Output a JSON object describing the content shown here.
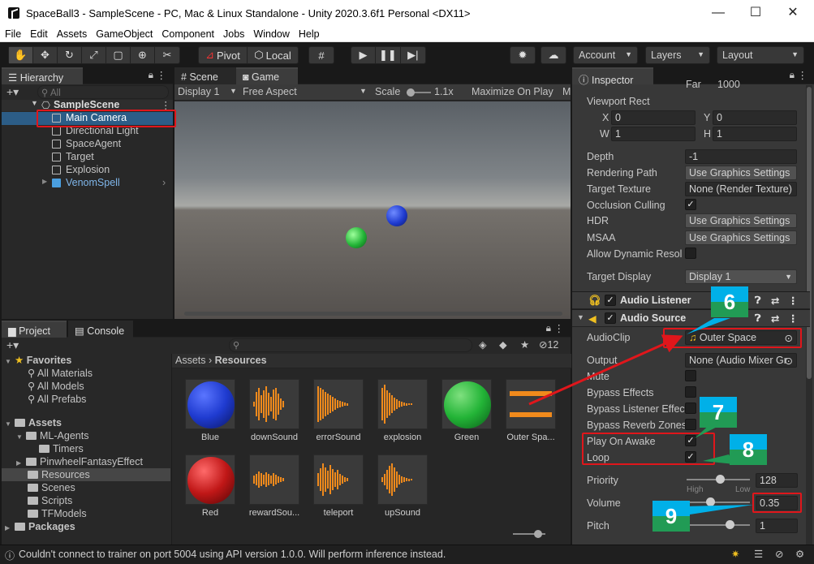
{
  "window": {
    "title": "SpaceBall3 - SampleScene - PC, Mac & Linux Standalone - Unity 2020.3.6f1 Personal <DX11>",
    "minimize": "—",
    "maximize": "☐",
    "close": "✕"
  },
  "menu": [
    "File",
    "Edit",
    "Assets",
    "GameObject",
    "Component",
    "Jobs",
    "Window",
    "Help"
  ],
  "toolbar": {
    "pivot": "Pivot",
    "local": "Local",
    "account": "Account",
    "layers": "Layers",
    "layout": "Layout"
  },
  "hierarchy": {
    "tab": "Hierarchy",
    "search_placeholder": "All",
    "scene": "SampleScene",
    "items": [
      "Main Camera",
      "Directional Light",
      "SpaceAgent",
      "Target",
      "Explosion",
      "VenomSpell"
    ]
  },
  "scene_tabs": {
    "scene": "Scene",
    "game": "Game"
  },
  "game_toolbar": {
    "display": "Display 1",
    "aspect": "Free Aspect",
    "scale_label": "Scale",
    "scale_value": "1.1x",
    "maximize": "Maximize On Play",
    "more": "M"
  },
  "project": {
    "tab_project": "Project",
    "tab_console": "Console",
    "hidden_count": "12",
    "breadcrumb_root": "Assets",
    "breadcrumb_current": "Resources",
    "tree": {
      "favorites": "Favorites",
      "fav_items": [
        "All Materials",
        "All Models",
        "All Prefabs"
      ],
      "assets": "Assets",
      "ml_agents": "ML-Agents",
      "timers": "Timers",
      "pinwheel": "PinwheelFantasyEffect",
      "resources": "Resources",
      "scenes": "Scenes",
      "scripts": "Scripts",
      "tfmodels": "TFModels",
      "packages": "Packages"
    },
    "assets": [
      "Blue",
      "downSound",
      "errorSound",
      "explosion",
      "Green",
      "Outer Spa...",
      "Red",
      "rewardSou...",
      "teleport",
      "upSound"
    ]
  },
  "inspector": {
    "tab": "Inspector",
    "far_label": "Far",
    "far_value": "1000",
    "viewport_label": "Viewport Rect",
    "x_label": "X",
    "x_value": "0",
    "y_label": "Y",
    "y_value": "0",
    "w_label": "W",
    "w_value": "1",
    "h_label": "H",
    "h_value": "1",
    "depth_label": "Depth",
    "depth_value": "-1",
    "render_path_label": "Rendering Path",
    "render_path_value": "Use Graphics Settings",
    "target_tex_label": "Target Texture",
    "target_tex_value": "None (Render Texture)",
    "occlusion_label": "Occlusion Culling",
    "hdr_label": "HDR",
    "hdr_value": "Use Graphics Settings",
    "msaa_label": "MSAA",
    "msaa_value": "Use Graphics Settings",
    "dynres_label": "Allow Dynamic Resol",
    "target_display_label": "Target Display",
    "target_display_value": "Display 1",
    "audio_listener": "Audio Listener",
    "audio_source": "Audio Source",
    "audioclip_label": "AudioClip",
    "audioclip_value": "Outer Space",
    "output_label": "Output",
    "output_value": "None (Audio Mixer Gr",
    "mute_label": "Mute",
    "bypass_effects_label": "Bypass Effects",
    "bypass_listener_label": "Bypass Listener Effec",
    "bypass_reverb_label": "Bypass Reverb Zones",
    "play_on_awake_label": "Play On Awake",
    "loop_label": "Loop",
    "priority_label": "Priority",
    "priority_value": "128",
    "high_label": "High",
    "low_label": "Low",
    "volume_label": "Volume",
    "volume_value": "0.35",
    "pitch_label": "Pitch",
    "pitch_value": "1"
  },
  "callouts": [
    "6",
    "7",
    "8",
    "9"
  ],
  "status": {
    "message": "Couldn't connect to trainer on port 5004 using API version 1.0.0. Will perform inference instead."
  },
  "colors": {
    "selection": "#2c5d87",
    "highlight": "#e0161b",
    "play_blue": "#00b0e8",
    "play_green": "#219b55",
    "ball_blue": "#1f3bd0",
    "ball_green": "#23b437",
    "ball_red": "#c01717",
    "wave": "#f08a1c"
  }
}
